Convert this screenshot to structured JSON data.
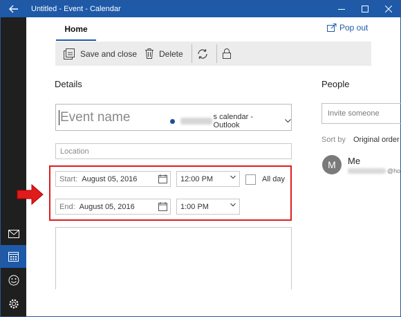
{
  "window": {
    "title": "Untitled - Event - Calendar",
    "icons": {
      "back": "back-arrow-icon",
      "minimize": "minimize-icon",
      "maximize": "maximize-icon",
      "close": "close-icon"
    }
  },
  "tabs": {
    "home": "Home",
    "popout": "Pop out"
  },
  "toolbar": {
    "save_close": "Save and close",
    "delete": "Delete",
    "icons": {
      "save": "save-close-icon",
      "delete": "trash-icon",
      "repeat": "repeat-icon",
      "private": "lock-icon"
    }
  },
  "details": {
    "heading": "Details",
    "event_name_placeholder": "Event name",
    "calendar_suffix": "s calendar - Outlook",
    "calendar_color": "#1e4e9a",
    "location_placeholder": "Location",
    "start_label": "Start:",
    "start_date": "August 05, 2016",
    "start_time": "12:00 PM",
    "end_label": "End:",
    "end_date": "August 05, 2016",
    "end_time": "1:00 PM",
    "all_day_label": "All day",
    "all_day_checked": false
  },
  "people": {
    "heading": "People",
    "invite_placeholder": "Invite someone",
    "sort_label": "Sort by",
    "sort_value": "Original order",
    "me": {
      "initial": "M",
      "name": "Me",
      "email_suffix": "@hot"
    }
  },
  "rail": {
    "items": [
      {
        "name": "mail",
        "icon": "mail-icon",
        "active": false
      },
      {
        "name": "calendar",
        "icon": "calendar-icon",
        "active": true
      },
      {
        "name": "feedback",
        "icon": "smiley-icon",
        "active": false
      },
      {
        "name": "settings",
        "icon": "gear-icon",
        "active": false
      }
    ]
  },
  "colors": {
    "accent": "#1e5aa8",
    "rail_background": "#1f1f1f",
    "annotation_red": "#e01b1b"
  }
}
